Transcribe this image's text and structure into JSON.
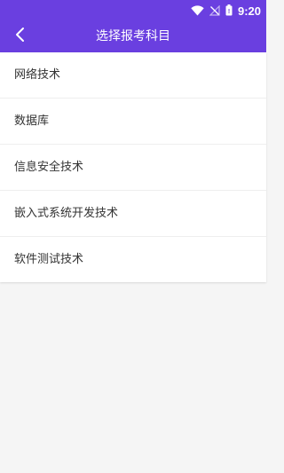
{
  "status_bar": {
    "time": "9:20",
    "icons": [
      "wifi-icon",
      "no-signal-icon",
      "battery-icon"
    ]
  },
  "toolbar": {
    "title": "选择报考科目",
    "back_icon": "chevron-left-icon"
  },
  "subjects": [
    {
      "label": "网络技术"
    },
    {
      "label": "数据库"
    },
    {
      "label": "信息安全技术"
    },
    {
      "label": "嵌入式系统开发技术"
    },
    {
      "label": "软件测试技术"
    }
  ],
  "colors": {
    "accent": "#6a3fe0",
    "background": "#f5f5f5",
    "list_bg": "#ffffff",
    "text": "#333333"
  }
}
